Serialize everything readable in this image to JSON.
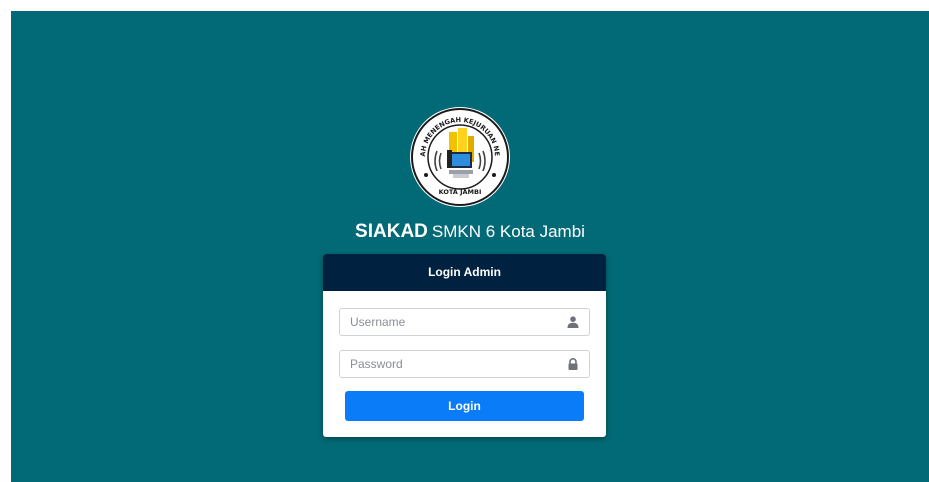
{
  "header": {
    "app_name": "SIAKAD",
    "school_name": "SMKN 6 Kota Jambi"
  },
  "logo": {
    "ring_text": "SEKOLAH MENENGAH KEJURUAN NEGERI 6",
    "bottom_text": "KOTA JAMBI"
  },
  "login_form": {
    "title": "Login Admin",
    "username_placeholder": "Username",
    "username_value": "",
    "password_placeholder": "Password",
    "password_value": "",
    "submit_label": "Login",
    "username_icon": "user-icon",
    "password_icon": "lock-icon"
  },
  "colors": {
    "background": "#026a76",
    "card_header": "#00213f",
    "button": "#0a7cf7"
  }
}
